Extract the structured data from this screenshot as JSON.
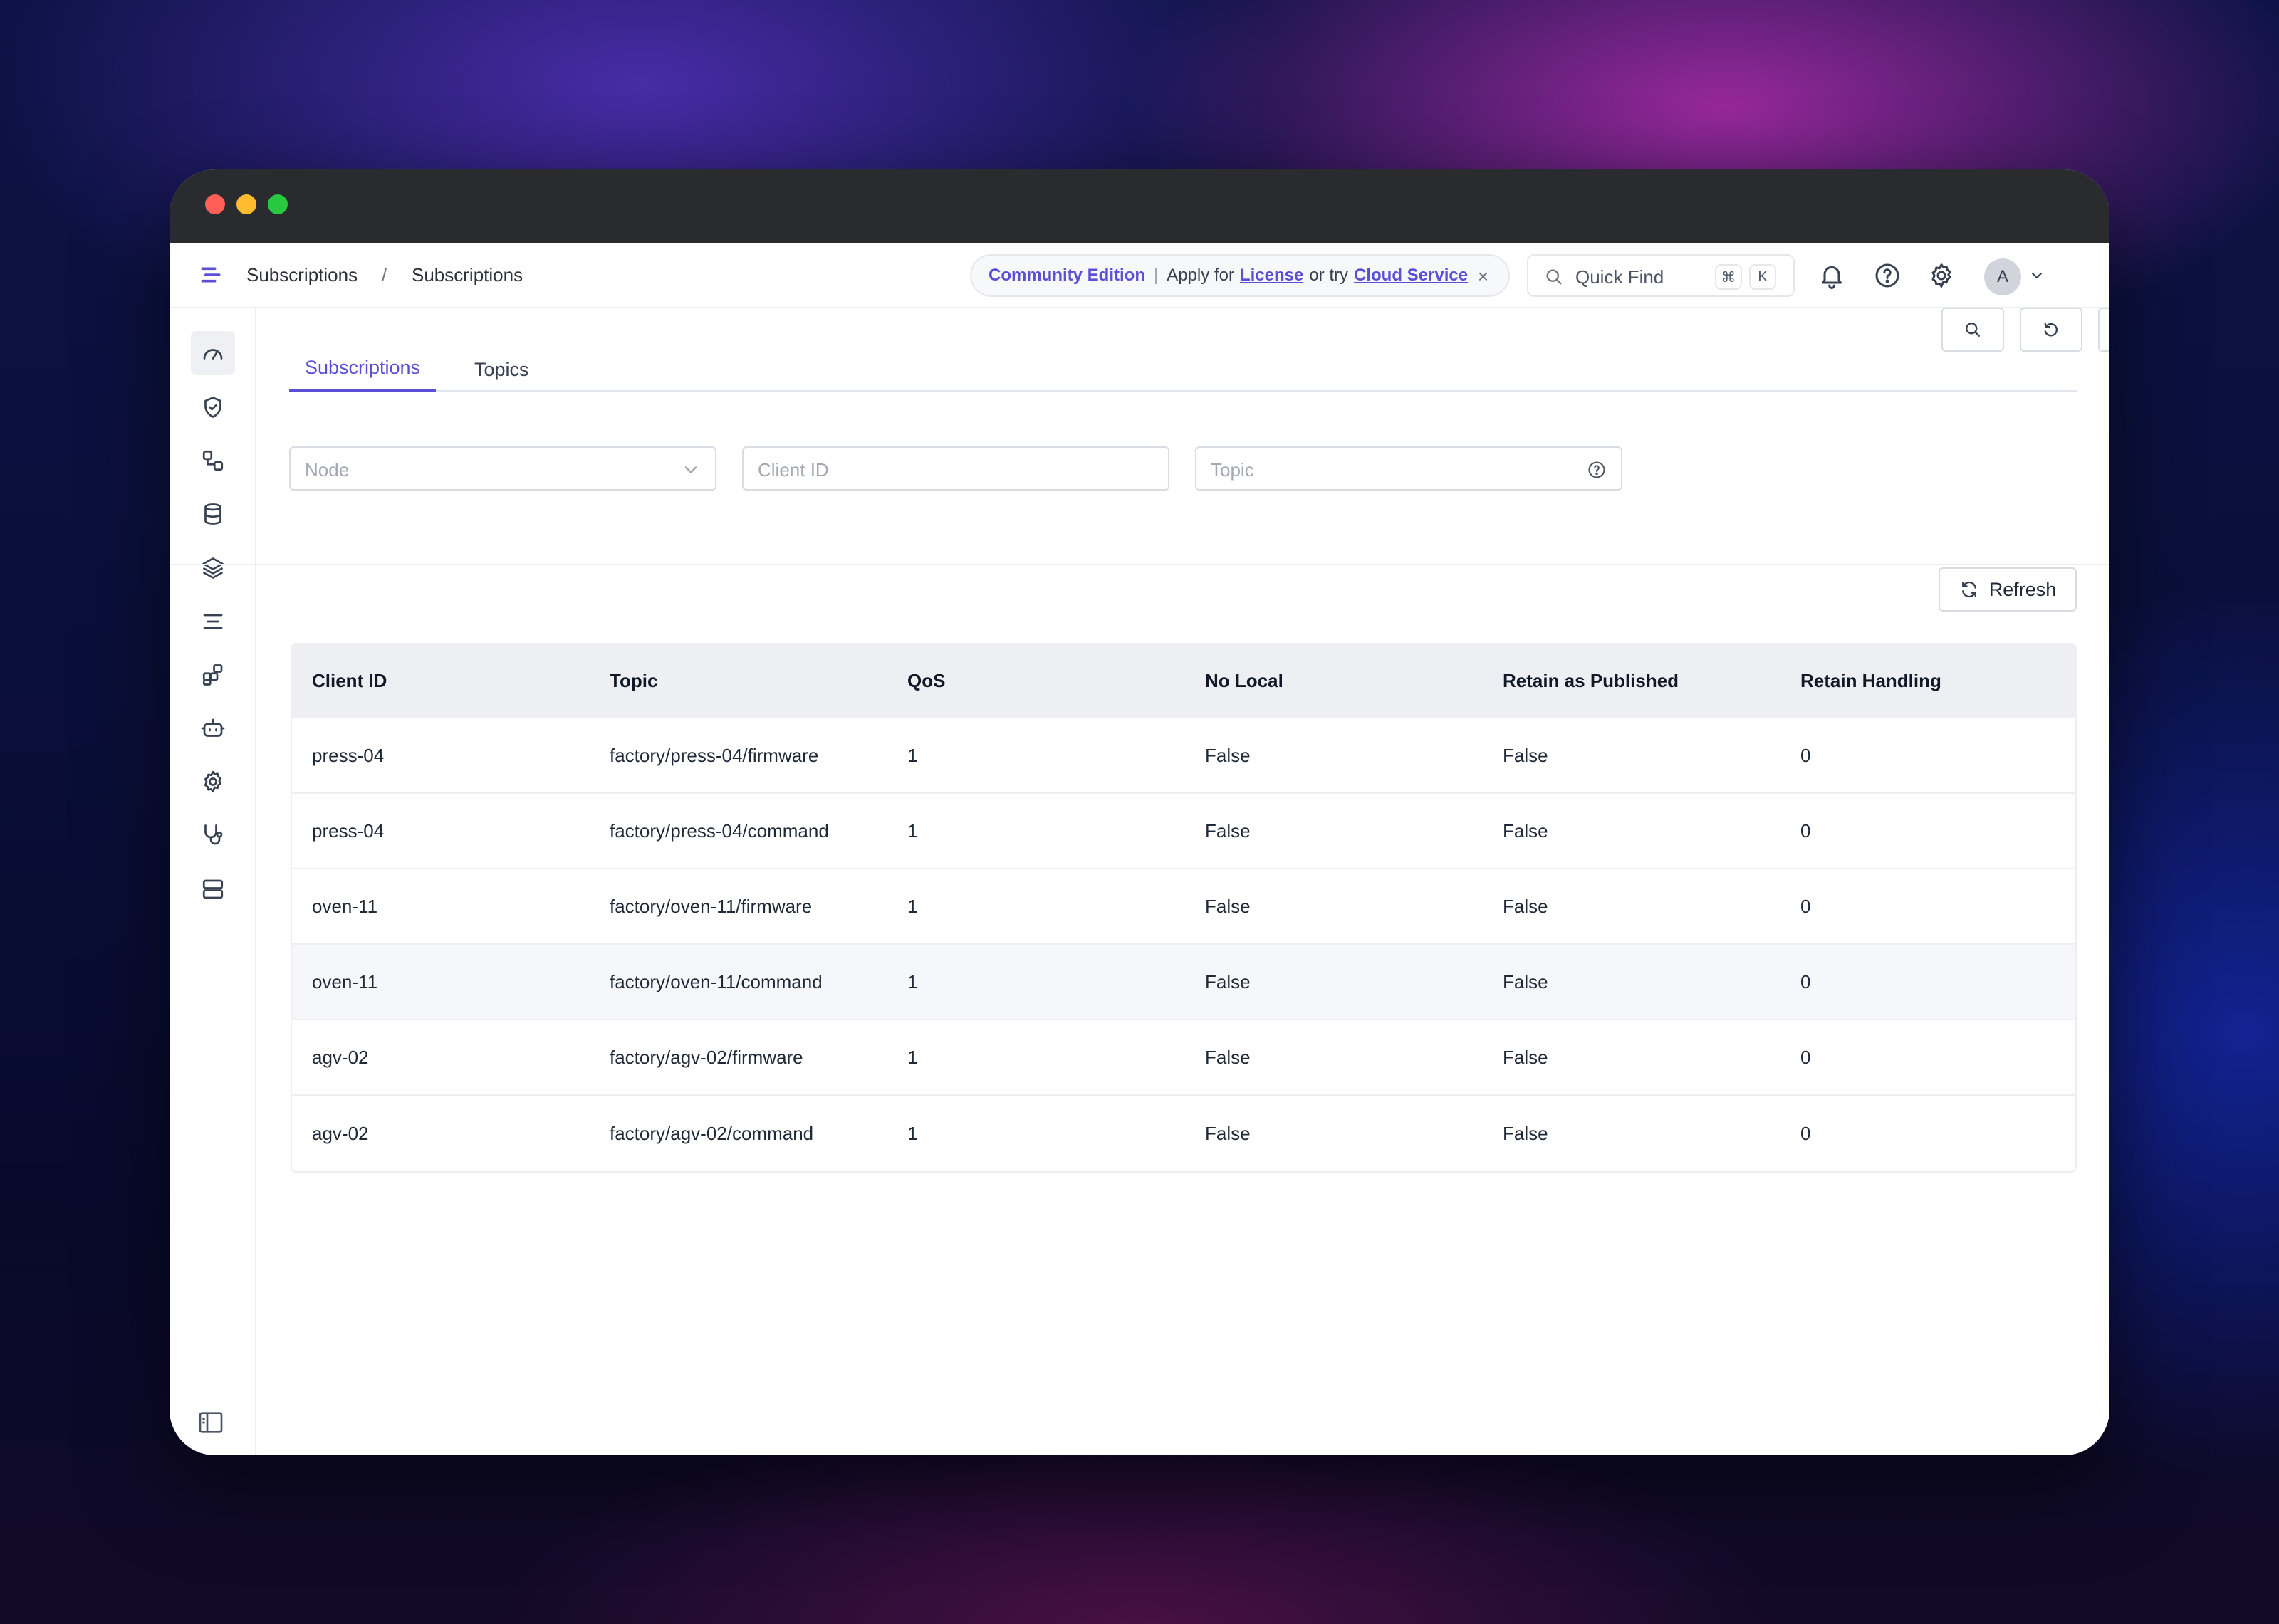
{
  "breadcrumb": {
    "section": "Subscriptions",
    "separator": "/",
    "page": "Subscriptions"
  },
  "banner": {
    "edition": "Community Edition",
    "divider": "|",
    "apply_text": "Apply for",
    "license_link": "License",
    "or_try_text": "or try",
    "cloud_link": "Cloud Service",
    "close": "×"
  },
  "quick_find": {
    "label": "Quick Find",
    "key_mod": "⌘",
    "key_letter": "K"
  },
  "user": {
    "avatar_initial": "A"
  },
  "tabs": [
    {
      "label": "Subscriptions",
      "active": true
    },
    {
      "label": "Topics",
      "active": false
    }
  ],
  "filters": {
    "node_placeholder": "Node",
    "client_placeholder": "Client ID",
    "topic_placeholder": "Topic"
  },
  "actions": {
    "refresh_label": "Refresh"
  },
  "table": {
    "columns": [
      "Client ID",
      "Topic",
      "QoS",
      "No Local",
      "Retain as Published",
      "Retain Handling"
    ],
    "rows": [
      [
        "press-04",
        "factory/press-04/firmware",
        "1",
        "False",
        "False",
        "0"
      ],
      [
        "press-04",
        "factory/press-04/command",
        "1",
        "False",
        "False",
        "0"
      ],
      [
        "oven-11",
        "factory/oven-11/firmware",
        "1",
        "False",
        "False",
        "0"
      ],
      [
        "oven-11",
        "factory/oven-11/command",
        "1",
        "False",
        "False",
        "0"
      ],
      [
        "agv-02",
        "factory/agv-02/firmware",
        "1",
        "False",
        "False",
        "0"
      ],
      [
        "agv-02",
        "factory/agv-02/command",
        "1",
        "False",
        "False",
        "0"
      ]
    ]
  },
  "colors": {
    "accent": "#5b4fd6",
    "titlebar": "#2a2b2f",
    "header_row": "#eeeff3"
  },
  "sidebar_icons": [
    "dashboard-icon",
    "shield-check-icon",
    "connections-icon",
    "database-icon",
    "layers-icon",
    "list-icon",
    "extensions-icon",
    "bot-icon",
    "settings-icon",
    "diagnose-icon",
    "server-icon"
  ]
}
